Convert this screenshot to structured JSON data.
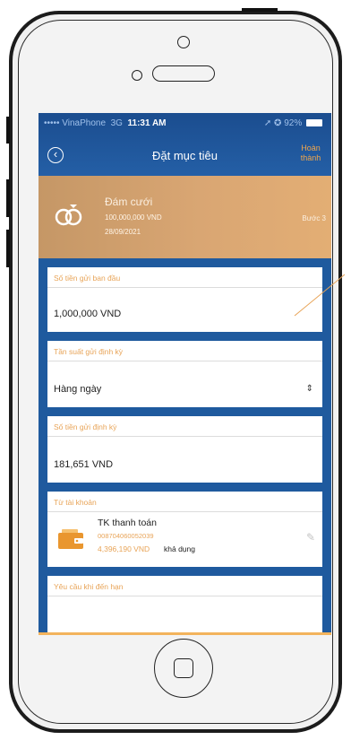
{
  "status_bar": {
    "carrier": "••••• VinaPhone",
    "network": "3G",
    "time": "11:31 AM",
    "right": "➚ ✪ 92%"
  },
  "header": {
    "title": "Đặt mục tiêu",
    "done_line1": "Hoàn",
    "done_line2": "thành"
  },
  "goal": {
    "name": "Đám cưới",
    "amount": "100,000,000 VND",
    "date": "28/09/2021",
    "step": "Bước 3"
  },
  "form": {
    "initial_deposit": {
      "label": "Số tiền gửi ban đầu",
      "value": "1,000,000 VND"
    },
    "frequency": {
      "label": "Tần suất gửi định kỳ",
      "value": "Hàng ngày"
    },
    "periodic_amount": {
      "label": "Số tiền gửi định kỳ",
      "value": "181,651 VND"
    },
    "from_account": {
      "label": "Từ tài khoản",
      "account_name": "TK thanh toán",
      "account_number": "008704060052039",
      "balance": "4,396,190 VND",
      "available": "khả dụng"
    },
    "maturity": {
      "label": "Yêu cầu khi đến hạn"
    }
  },
  "colors": {
    "header_blue": "#1f5a9e",
    "accent_orange": "#e8a458",
    "banner_gold": "#d9a673"
  }
}
